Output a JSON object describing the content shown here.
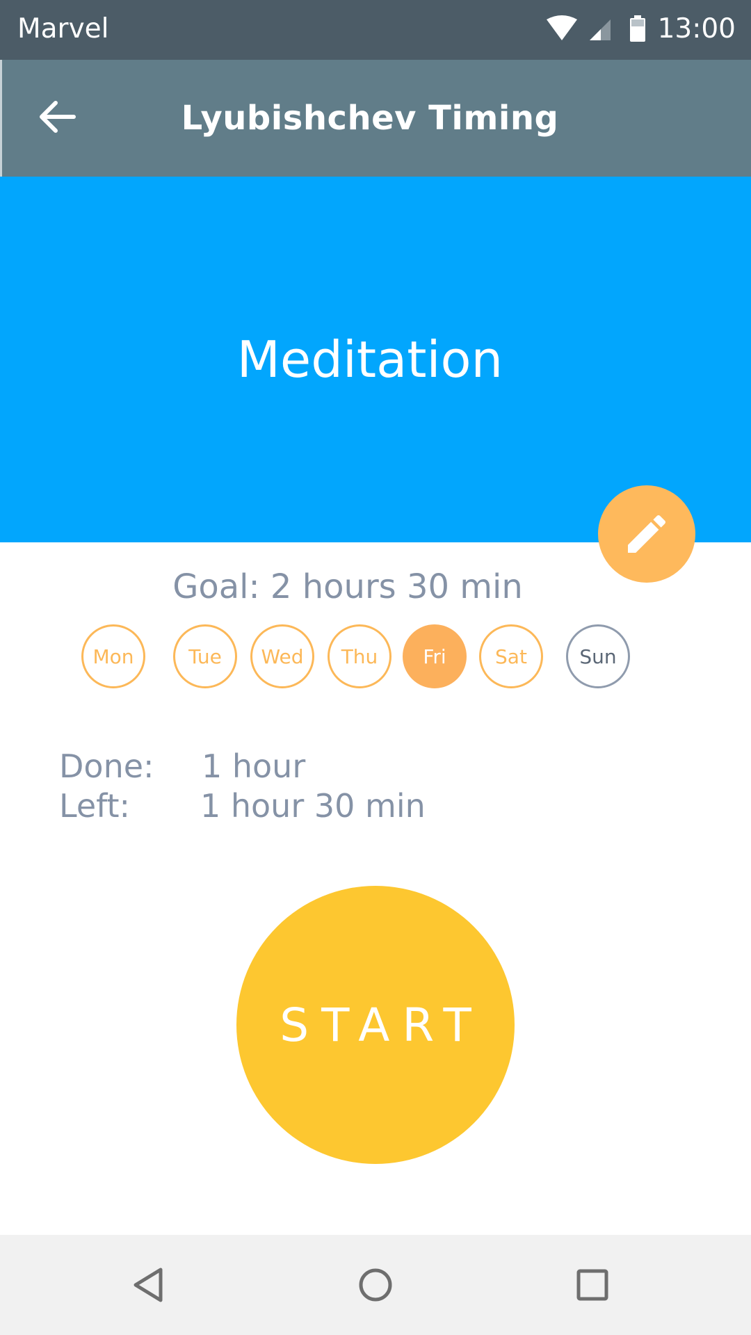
{
  "status_bar": {
    "carrier": "Marvel",
    "time": "13:00",
    "icons": [
      "wifi-icon",
      "cellular-signal-icon",
      "battery-icon"
    ]
  },
  "app_bar": {
    "title": "Lyubishchev Timing",
    "back_icon": "arrow-left-icon"
  },
  "activity": {
    "name": "Meditation",
    "edit_icon": "pencil-icon"
  },
  "goal": {
    "text": "Goal: 2 hours 30 min"
  },
  "days": [
    {
      "label": "Mon",
      "state": "scheduled"
    },
    {
      "label": "Tue",
      "state": "scheduled"
    },
    {
      "label": "Wed",
      "state": "scheduled"
    },
    {
      "label": "Thu",
      "state": "scheduled"
    },
    {
      "label": "Fri",
      "state": "selected"
    },
    {
      "label": "Sat",
      "state": "scheduled"
    },
    {
      "label": "Sun",
      "state": "unscheduled"
    }
  ],
  "stats": {
    "done_label": "Done:",
    "done_value": "1 hour",
    "left_label": "Left:",
    "left_value": "1 hour 30 min"
  },
  "start": {
    "label": "START"
  },
  "nav_bar": {
    "icons": [
      "back-triangle-icon",
      "home-circle-icon",
      "recents-square-icon"
    ]
  },
  "colors": {
    "status_bar": "#4c5c67",
    "app_bar": "#617d89",
    "hero": "#02a6fd",
    "accent_orange": "#fcb058",
    "start_yellow": "#fdc730",
    "text_gray": "#8592a6",
    "nav_bar": "#f1f1f1"
  }
}
